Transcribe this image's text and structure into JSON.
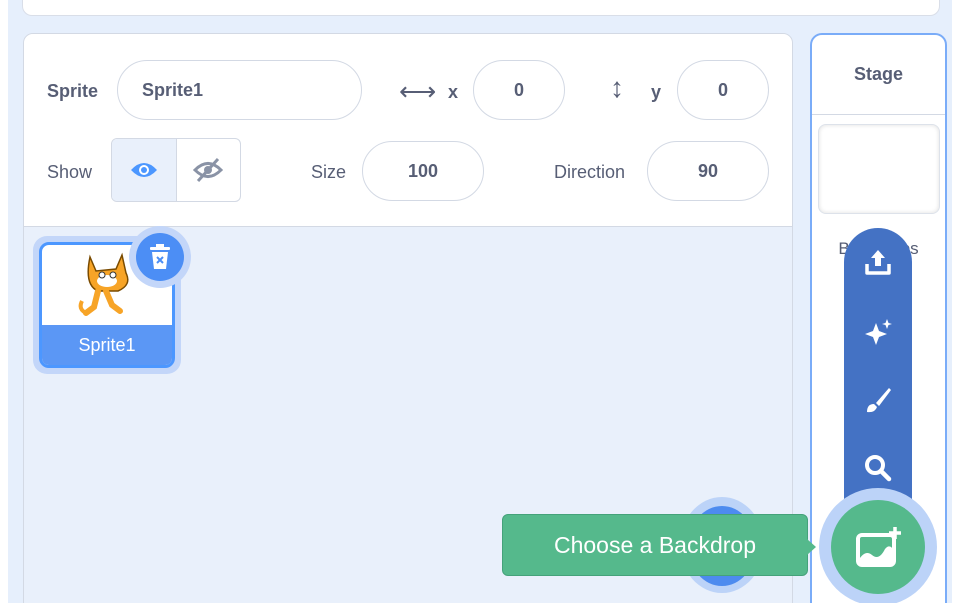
{
  "sprite_info": {
    "sprite_label": "Sprite",
    "sprite_name": "Sprite1",
    "x_label": "x",
    "x_value": "0",
    "y_label": "y",
    "y_value": "0",
    "show_label": "Show",
    "size_label": "Size",
    "size_value": "100",
    "direction_label": "Direction",
    "direction_value": "90"
  },
  "sprites": [
    {
      "name": "Sprite1"
    }
  ],
  "stage": {
    "title": "Stage",
    "backdrops_label": "Backdrops"
  },
  "backdrop_menu": {
    "items": [
      "upload-icon",
      "surprise-icon",
      "paint-icon",
      "search-icon"
    ],
    "tooltip": "Choose a Backdrop"
  },
  "colors": {
    "accent": "#4c97ff",
    "menu": "#4472c4",
    "green": "#55b98c"
  }
}
